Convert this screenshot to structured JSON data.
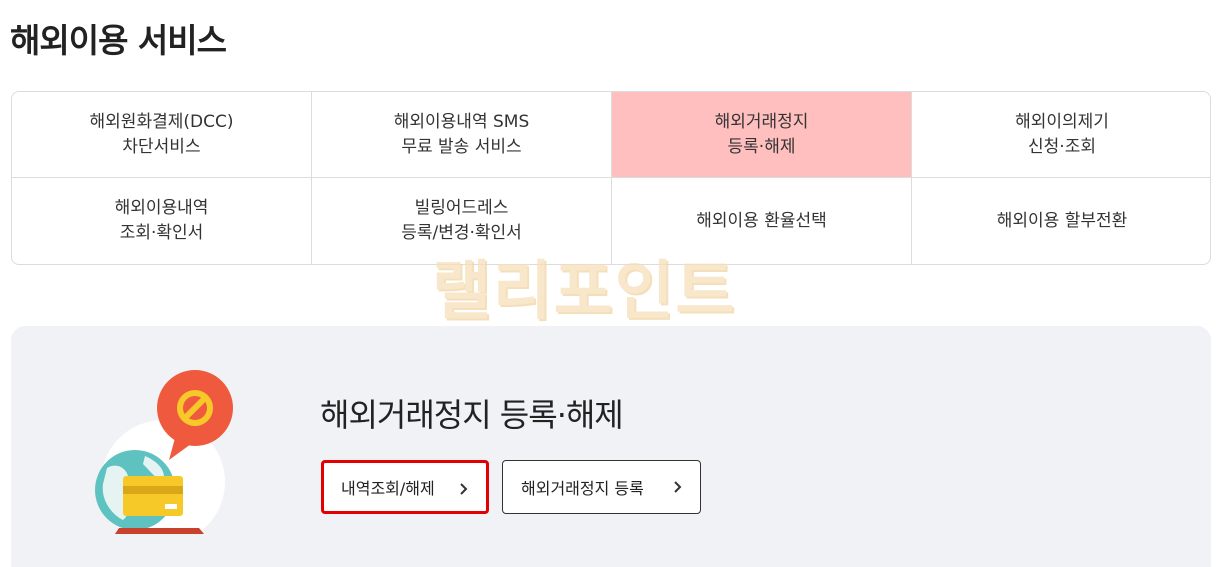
{
  "page": {
    "title": "해외이용 서비스"
  },
  "services": [
    {
      "line1": "해외원화결제(DCC)",
      "line2": "차단서비스",
      "active": false
    },
    {
      "line1": "해외이용내역 SMS",
      "line2": "무료 발송 서비스",
      "active": false
    },
    {
      "line1": "해외거래정지",
      "line2": "등록·해제",
      "active": true
    },
    {
      "line1": "해외이의제기",
      "line2": "신청·조회",
      "active": false
    },
    {
      "line1": "해외이용내역",
      "line2": "조회·확인서",
      "active": false
    },
    {
      "line1": "빌링어드레스",
      "line2": "등록/변경·확인서",
      "active": false
    },
    {
      "line1": "해외이용 환율선택",
      "line2": "",
      "active": false
    },
    {
      "line1": "해외이용 할부전환",
      "line2": "",
      "active": false
    }
  ],
  "detail": {
    "title": "해외거래정지 등록·해제",
    "buttons": {
      "history_label": "내역조회/해제",
      "register_label": "해외거래정지 등록"
    }
  },
  "watermark": {
    "text": "랠리포인트"
  },
  "colors": {
    "active_cell_bg": "#ffbfbf",
    "panel_bg": "#f0f2f6",
    "highlight_border": "#e20000"
  },
  "icons": {
    "chevron": "chevron-right-icon",
    "illustration": "globe-card-block-icon"
  }
}
